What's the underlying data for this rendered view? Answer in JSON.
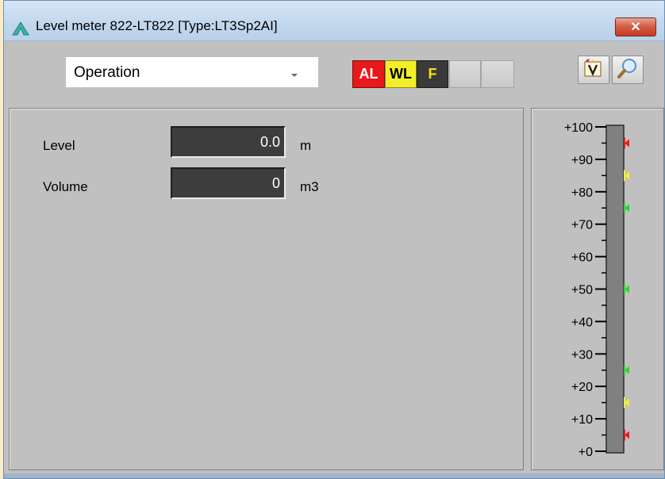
{
  "window": {
    "title": "Level meter 822-LT822  [Type:LT3Sp2AI]",
    "close_label": "✕"
  },
  "toolbar": {
    "mode_select": {
      "value": "Operation"
    },
    "badges": {
      "al": "AL",
      "wl": "WL",
      "f": "F"
    }
  },
  "rows": [
    {
      "label": "Level",
      "value": "0.0",
      "unit": "m"
    },
    {
      "label": "Volume",
      "value": "0",
      "unit": "m3"
    }
  ],
  "scale": {
    "min": 0,
    "max": 100,
    "major_step": 10,
    "minor_step": 5,
    "tick_labels": [
      "+100",
      "+90",
      "+80",
      "+70",
      "+60",
      "+50",
      "+40",
      "+30",
      "+20",
      "+10",
      "+0"
    ],
    "current_level": 0,
    "markers": [
      {
        "value": 95,
        "color": "#e8191b"
      },
      {
        "value": 85,
        "color": "#f2ef2a"
      },
      {
        "value": 75,
        "color": "#2fd32f"
      },
      {
        "value": 50,
        "color": "#2fd32f"
      },
      {
        "value": 25,
        "color": "#2fd32f"
      },
      {
        "value": 15,
        "color": "#f2ef2a"
      },
      {
        "value": 5,
        "color": "#e8191b"
      }
    ]
  },
  "colors": {
    "alarm": "#e8191b",
    "warning": "#f2ef2a",
    "ok": "#2fd32f",
    "panel": "#c0c0c0",
    "value_bg": "#3d3d3d"
  }
}
